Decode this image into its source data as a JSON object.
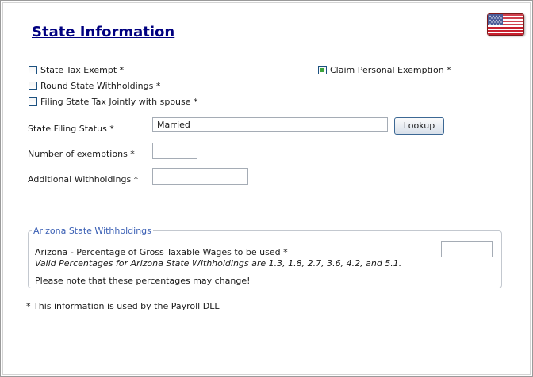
{
  "page": {
    "title": "State Information",
    "flag_icon": "us-flag-icon"
  },
  "checkboxes": {
    "state_tax_exempt": {
      "label": "State Tax Exempt *",
      "checked": false
    },
    "round_state_withholdings": {
      "label": "Round State Withholdings *",
      "checked": false
    },
    "filing_jointly": {
      "label": "Filing State Tax Jointly with spouse *",
      "checked": false
    },
    "claim_personal_exemption": {
      "label": "Claim Personal Exemption *",
      "checked": true
    }
  },
  "fields": {
    "filing_status": {
      "label": "State Filing Status *",
      "value": "Married"
    },
    "lookup_button": {
      "label": "Lookup"
    },
    "exemptions": {
      "label": "Number of exemptions *",
      "value": ""
    },
    "additional_withholdings": {
      "label": "Additional Withholdings *",
      "value": ""
    }
  },
  "arizona": {
    "legend": "Arizona State Withholdings",
    "percentage_label": "Arizona - Percentage of Gross Taxable Wages to be used *",
    "valid_note": "Valid Percentages for Arizona State Withholdings are 1.3, 1.8, 2.7, 3.6, 4.2, and 5.1.",
    "change_note": "Please note that these percentages may change!",
    "percentage_value": ""
  },
  "footer": {
    "note": "* This information is used by the Payroll DLL"
  },
  "colors": {
    "title": "#000080",
    "legend": "#3a5fb4",
    "checked_fill": "#3ca33c"
  }
}
